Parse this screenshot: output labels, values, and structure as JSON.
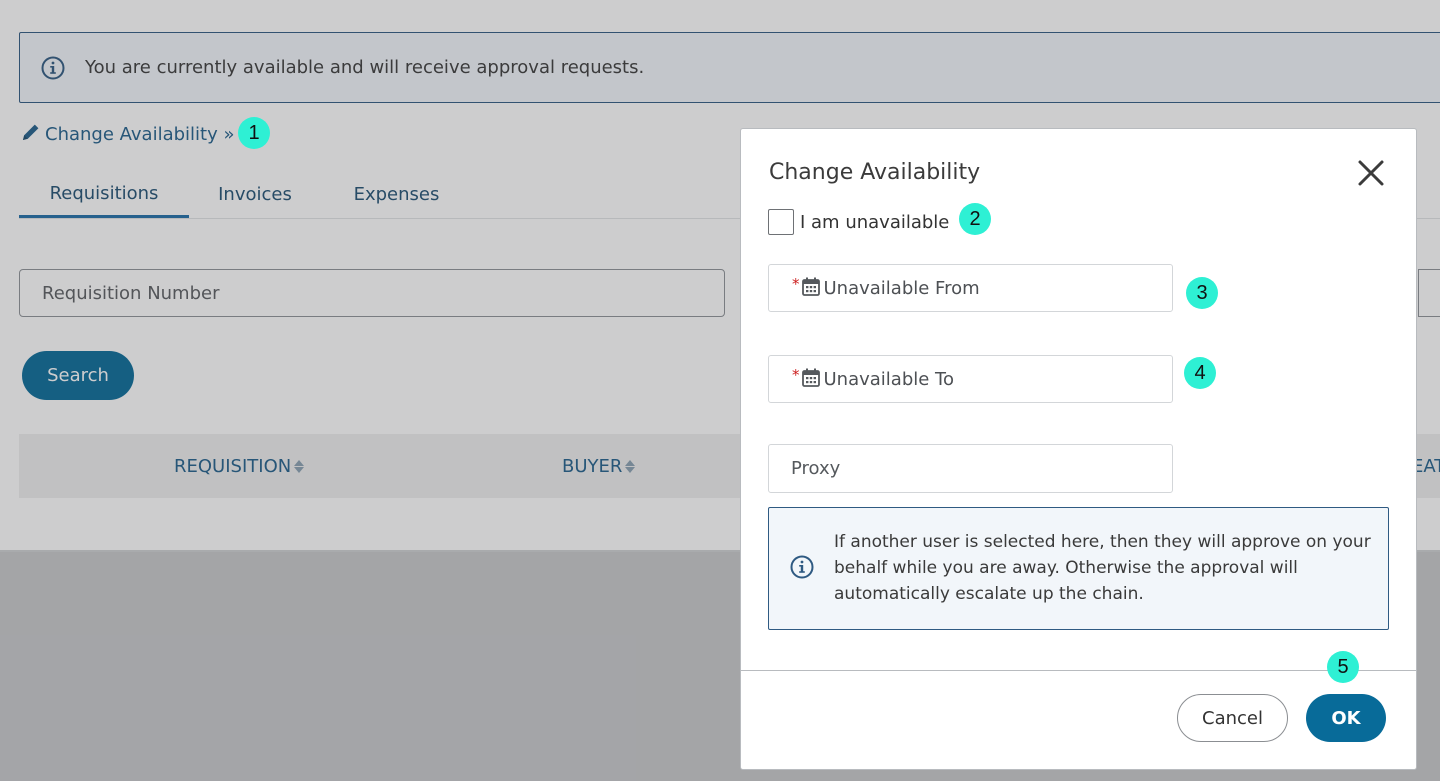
{
  "banner": {
    "icon": "info-icon",
    "text": "You are currently available and will receive approval requests."
  },
  "change_link": {
    "icon": "pencil-icon",
    "label": "Change Availability »"
  },
  "tabs": [
    {
      "label": "Requisitions",
      "active": true
    },
    {
      "label": "Invoices",
      "active": false
    },
    {
      "label": "Expenses",
      "active": false
    }
  ],
  "search": {
    "placeholder": "Requisition Number",
    "button_label": "Search"
  },
  "table": {
    "columns": [
      "REQUISITION",
      "BUYER",
      "EAT"
    ]
  },
  "modal": {
    "title": "Change Availability",
    "close_icon": "close-icon",
    "checkbox_label": "I am unavailable",
    "checkbox_checked": false,
    "from_label": "Unavailable From",
    "to_label": "Unavailable To",
    "required_mark": "*",
    "calendar_icon": "calendar-icon",
    "proxy_placeholder": "Proxy",
    "note_text": "If another user is selected here, then they will approve on your behalf while you are away. Otherwise the approval will automatically escalate up the chain.",
    "cancel_label": "Cancel",
    "ok_label": "OK"
  },
  "markers": [
    "1",
    "2",
    "3",
    "4",
    "5"
  ],
  "colors": {
    "primary": "#086b99",
    "link": "#1f5f8b",
    "marker": "#2ef0d4",
    "required": "#cc1f1f"
  }
}
